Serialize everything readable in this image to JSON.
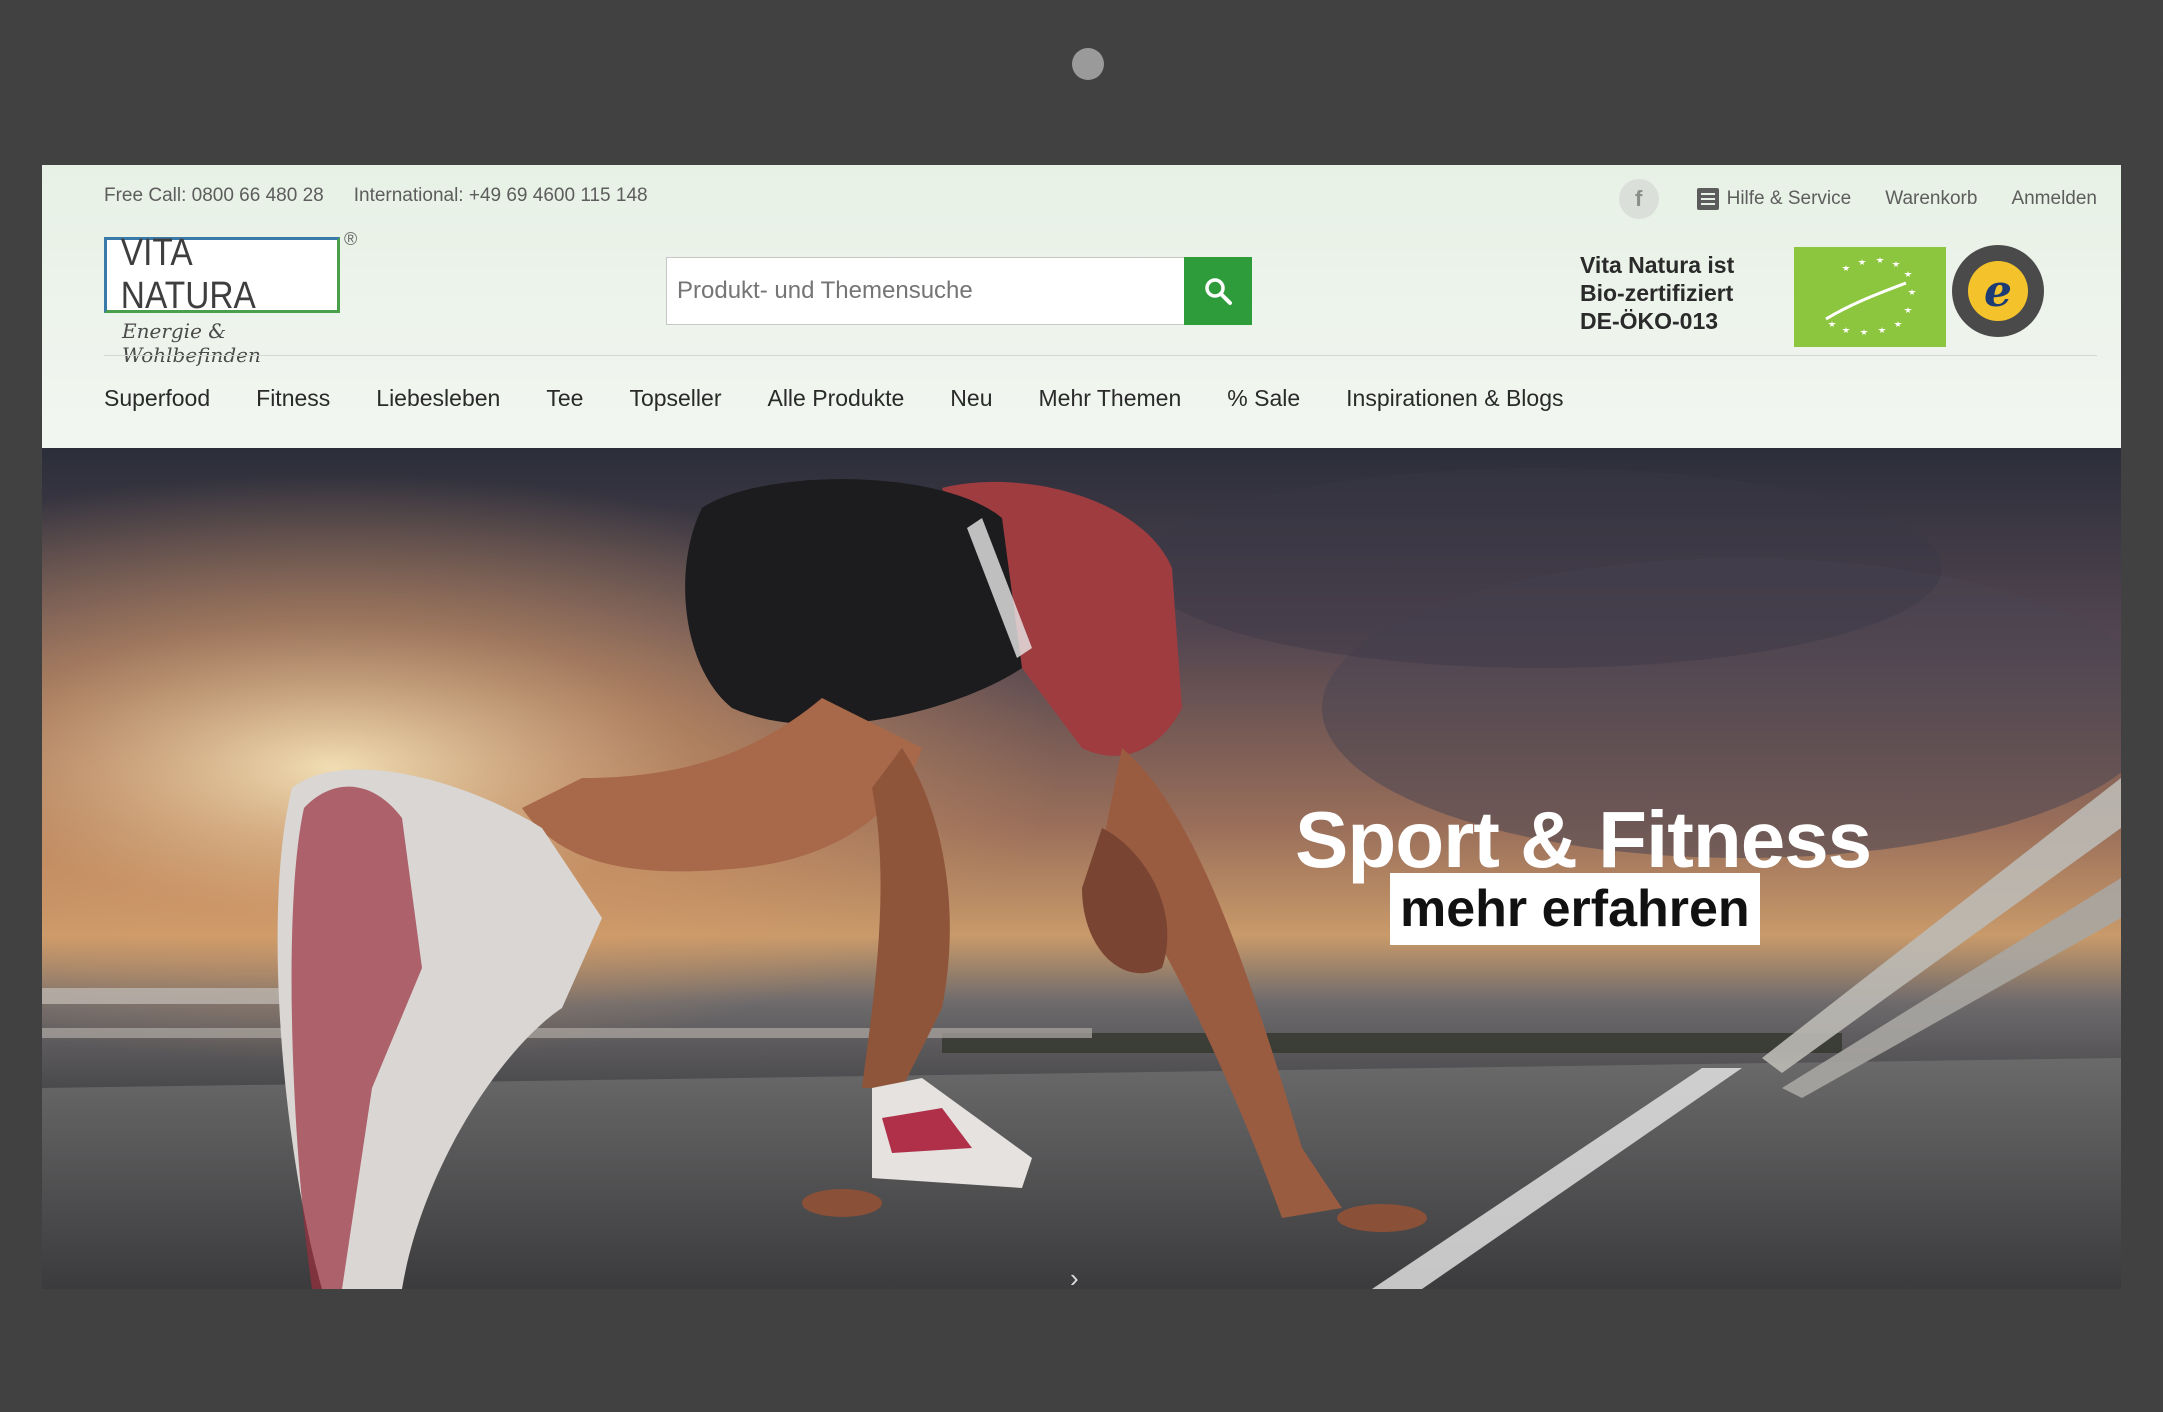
{
  "topbar": {
    "free_call": "Free Call: 0800 66 480 28",
    "international": "International: +49 69 4600 115 148",
    "facebook_icon": "f",
    "help": "Hilfe & Service",
    "cart": "Warenkorb",
    "login": "Anmelden"
  },
  "logo": {
    "text": "VITA NATURA",
    "registered": "®",
    "tagline": "Energie & Wohlbefinden"
  },
  "search": {
    "placeholder": "Produkt- und Themensuche"
  },
  "bio": {
    "line1": "Vita Natura ist",
    "line2": "Bio-zertifiziert",
    "line3": "DE-ÖKO-013"
  },
  "trusted": {
    "mark": "e"
  },
  "nav": [
    "Superfood",
    "Fitness",
    "Liebesleben",
    "Tee",
    "Topseller",
    "Alle Produkte",
    "Neu",
    "Mehr Themen",
    "% Sale",
    "Inspirationen & Blogs"
  ],
  "hero": {
    "title": "Sport & Fitness",
    "cta": "mehr erfahren",
    "arrow": "›"
  },
  "colors": {
    "accent_green": "#2e9c3a",
    "eu_leaf_green": "#8cc63f",
    "frame": "#414141"
  }
}
